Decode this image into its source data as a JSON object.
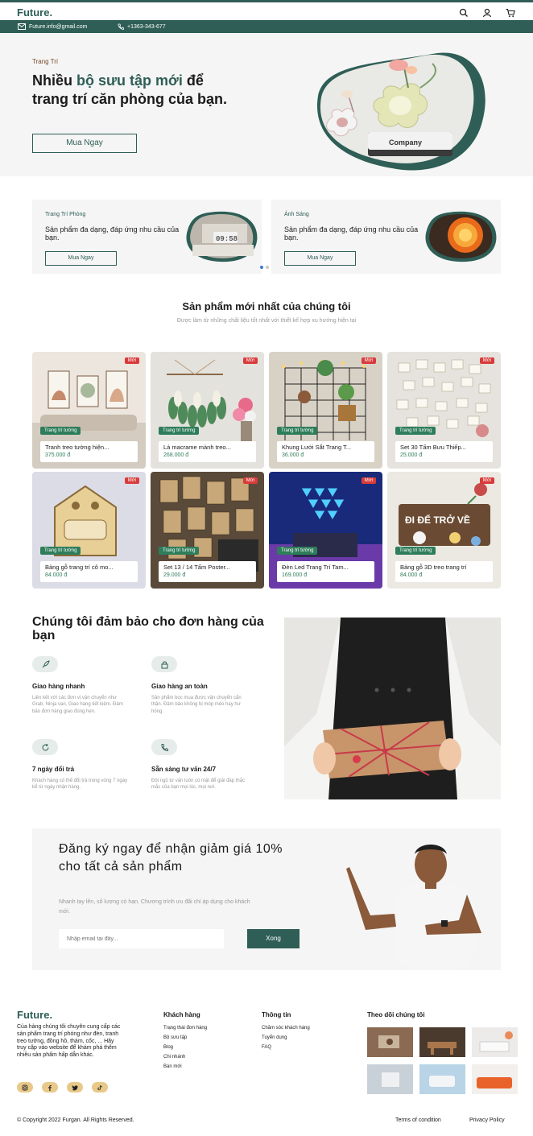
{
  "header": {
    "logo": "Future.",
    "email": "Future.info@gmail.com",
    "phone": "+1363-343-677"
  },
  "hero": {
    "eyebrow": "Trang Trí",
    "title_before": "Nhiều ",
    "title_highlight": "bộ sưu tập mới",
    "title_after": " để trang trí căn phòng của bạn.",
    "button": "Mua Ngay",
    "art_text": "Company"
  },
  "categories": [
    {
      "eyebrow": "Trang Trí Phòng",
      "text": "Sản phẩm đa dạng, đáp ứng nhu cầu của bạn.",
      "button": "Mua Ngay",
      "clock_text": "09:58"
    },
    {
      "eyebrow": "Ánh Sáng",
      "text": "Sản phẩm đa dạng, đáp ứng nhu cầu của bạn.",
      "button": "Mua Ngay"
    }
  ],
  "products_section": {
    "title": "Sản phẩm mới nhất của chúng tôi",
    "subtitle": "Được làm từ những chất liệu tốt nhất với thiết kế hợp xu hướng hiện tại"
  },
  "products": [
    {
      "badge": "Mới",
      "tag": "Trang trí tường",
      "name": "Tranh treo tường hiện...",
      "price": "375.000 đ"
    },
    {
      "badge": "Mới",
      "tag": "Trang trí tường",
      "name": "Lá macrame mành treo...",
      "price": "268.000 đ"
    },
    {
      "badge": "Mới",
      "tag": "Trang trí tường",
      "name": "Khung Lưới Sắt Trang T...",
      "price": "36.000 đ"
    },
    {
      "badge": "Mới",
      "tag": "Trang trí tường",
      "name": "Set 30 Tấm Bưu Thiếp...",
      "price": "25.000 đ"
    },
    {
      "badge": "Mới",
      "tag": "Trang trí tường",
      "name": "Bảng gỗ trang trí cô mo...",
      "price": "84.000 đ"
    },
    {
      "badge": "Mới",
      "tag": "Trang trí tường",
      "name": "Set 13 / 14 Tấm Poster...",
      "price": "29.000 đ"
    },
    {
      "badge": "Mới",
      "tag": "Trang trí tường",
      "name": "Đèn Led Trang Trí Tam...",
      "price": "169.000 đ"
    },
    {
      "badge": "Mới",
      "tag": "Trang trí tường",
      "name": "Bảng gỗ 3D treo trang trí",
      "price": "84.000 đ",
      "art_text": "ĐI ĐỂ TRỞ VỀ"
    }
  ],
  "guarantee": {
    "title": "Chúng tôi đảm bảo cho đơn hàng của bạn",
    "features": [
      {
        "icon": "rocket-icon",
        "title": "Giao hàng nhanh",
        "desc": "Liên kết với các đơn vị vận chuyển như Grab, Ninja van, Giao hàng tiết kiệm. Đảm bảo đơn hàng giao đúng hẹn."
      },
      {
        "icon": "lock-icon",
        "title": "Giao hàng an toàn",
        "desc": "Sản phẩm bọc mua được vận chuyển cẩn thận. Đảm bảo không bị móp méo hay hư hỏng."
      },
      {
        "icon": "refresh-icon",
        "title": "7 ngày đổi trả",
        "desc": "Khách hàng có thể đổi trả trong vòng 7 ngày kể từ ngày nhận hàng."
      },
      {
        "icon": "phone-icon",
        "title": "Sẵn sàng tư vấn 24/7",
        "desc": "Đội ngũ tư vấn luôn có mặt để giải đáp thắc mắc của bạn mọi lúc, mọi nơi."
      }
    ]
  },
  "newsletter": {
    "title": "Đăng ký ngay để nhận giảm giá 10% cho tất cả sản phẩm",
    "desc": "Nhanh tay lên, số lượng có hạn. Chương trình ưu đãi chỉ áp dụng cho khách mới.",
    "placeholder": "Nhập email tại đây...",
    "button": "Xong"
  },
  "footer": {
    "logo": "Future.",
    "about": "Của hàng chúng tôi chuyên cung cấp các sản phẩm trang trí phòng như đèn, tranh treo tường, đồng hồ, thảm, cốc, ... Hãy truy cập vào website để khám phá thêm nhiều sản phẩm hấp dẫn khác.",
    "socials": [
      "instagram-icon",
      "facebook-icon",
      "twitter-icon",
      "tiktok-icon"
    ],
    "columns": [
      {
        "title": "Khách hàng",
        "links": [
          "Trạng thái đơn hàng",
          "Bộ sưu tập",
          "Blog",
          "Chi nhánh",
          "Bán mới"
        ]
      },
      {
        "title": "Thông tin",
        "links": [
          "Chăm sóc khách hàng",
          "Tuyển dụng",
          "FAQ"
        ]
      }
    ],
    "follow_title": "Theo dõi chúng tôi",
    "copyright": "© Copyright 2022 Furgan. All Rights Reserved.",
    "terms": "Terms of condition",
    "privacy": "Privacy Policy"
  },
  "colors": {
    "brand": "#2e5e55",
    "badge": "#d93b3b",
    "tag": "#2e7d5b",
    "light_bg": "#f5f5f5"
  }
}
